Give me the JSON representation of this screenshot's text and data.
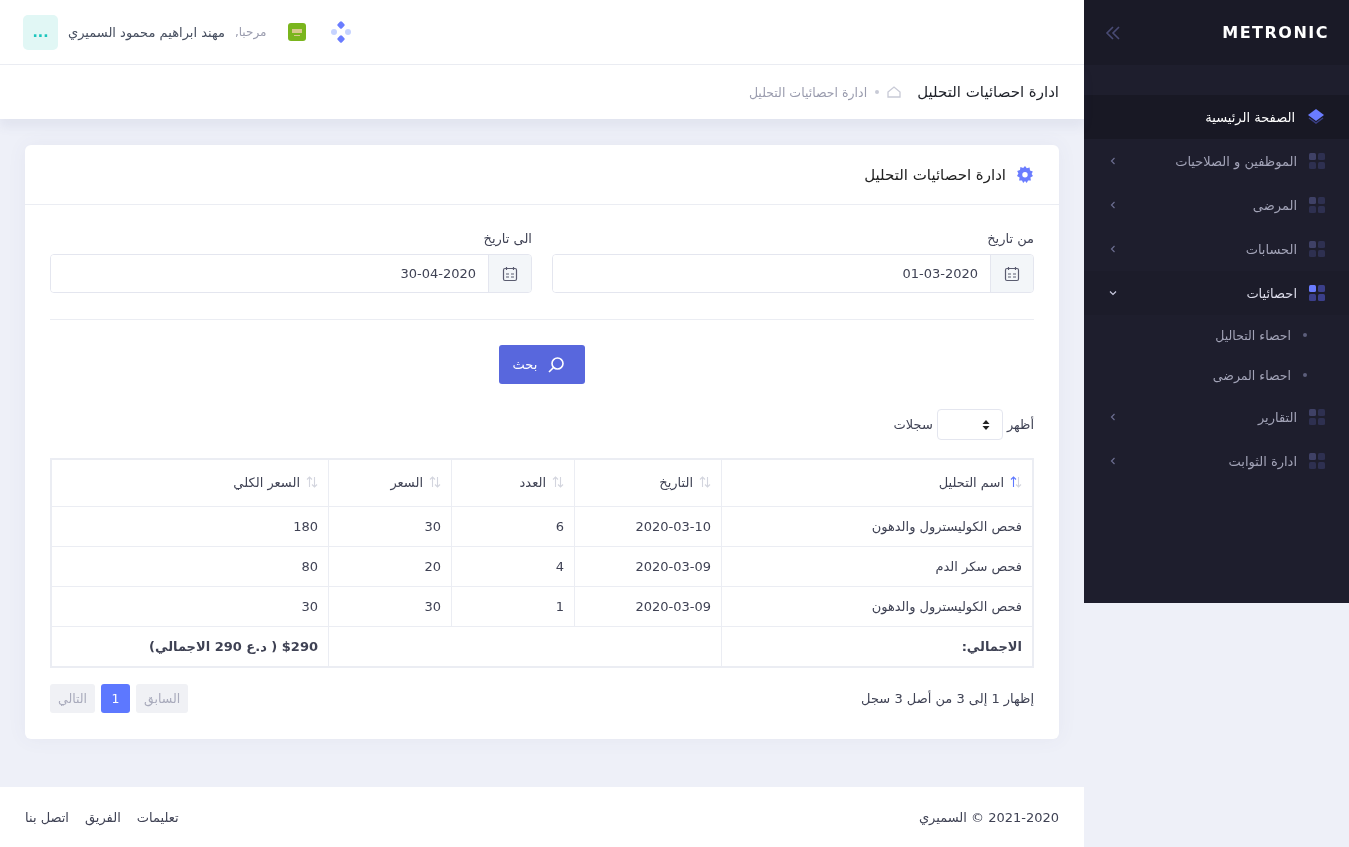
{
  "brand": "METRONIC",
  "user": {
    "greeting": "مرحبا,",
    "name": "مهند ابراهيم محمود السميري",
    "menu": "..."
  },
  "subheader": {
    "title": "ادارة احصائيات التحليل",
    "breadcrumbs": [
      "ادارة احصائيات التحليل"
    ]
  },
  "sidebar": {
    "items": [
      {
        "label": "الصفحة الرئيسية",
        "kind": "link",
        "selected": true,
        "expanded": false
      },
      {
        "label": "الموظفين و الصلاحيات",
        "kind": "group",
        "selected": false,
        "expanded": false
      },
      {
        "label": "المرضى",
        "kind": "group",
        "selected": false,
        "expanded": false
      },
      {
        "label": "الحسابات",
        "kind": "group",
        "selected": false,
        "expanded": false
      },
      {
        "label": "احصائيات",
        "kind": "group",
        "selected": false,
        "expanded": true,
        "children": [
          {
            "label": "احصاء التحاليل"
          },
          {
            "label": "احصاء المرضى"
          }
        ]
      },
      {
        "label": "التقارير",
        "kind": "group",
        "selected": false,
        "expanded": false
      },
      {
        "label": "ادارة الثوابت",
        "kind": "group",
        "selected": false,
        "expanded": false
      }
    ]
  },
  "card": {
    "title": "ادارة احصائيات التحليل",
    "fields": [
      {
        "label": "من تاريخ",
        "value": "01-03-2020"
      },
      {
        "label": "الى تاريخ",
        "value": "30-04-2020"
      }
    ],
    "search_button": "بحث",
    "length": {
      "before": "أظهر",
      "after": "سجلات"
    },
    "table": {
      "columns": [
        {
          "label": "اسم التحليل",
          "sorted": true
        },
        {
          "label": "التاريخ",
          "sorted": false
        },
        {
          "label": "العدد",
          "sorted": false
        },
        {
          "label": "السعر",
          "sorted": false
        },
        {
          "label": "السعر الكلي",
          "sorted": false
        }
      ],
      "rows": [
        [
          "فحص الكوليسترول والدهون",
          "2020-03-10",
          "6",
          "30",
          "180"
        ],
        [
          "فحص سكر الدم",
          "2020-03-09",
          "4",
          "20",
          "80"
        ],
        [
          "فحص الكوليسترول والدهون",
          "2020-03-09",
          "1",
          "30",
          "30"
        ]
      ],
      "total": {
        "label": "الاجمالي:",
        "value": "$290 ( د.ع 290 الاجمالي)"
      }
    },
    "info": "إظهار 1 إلى 3 من أصل 3 سجل",
    "pagination": [
      {
        "label": "السابق",
        "selected": false,
        "disabled": true
      },
      {
        "label": "1",
        "selected": true,
        "disabled": false
      },
      {
        "label": "التالي",
        "selected": false,
        "disabled": true
      }
    ]
  },
  "footer": {
    "copyright": "2021-2020 © السميري",
    "links": [
      "تعليمات",
      "الفريق",
      "اتصل بنا"
    ]
  }
}
